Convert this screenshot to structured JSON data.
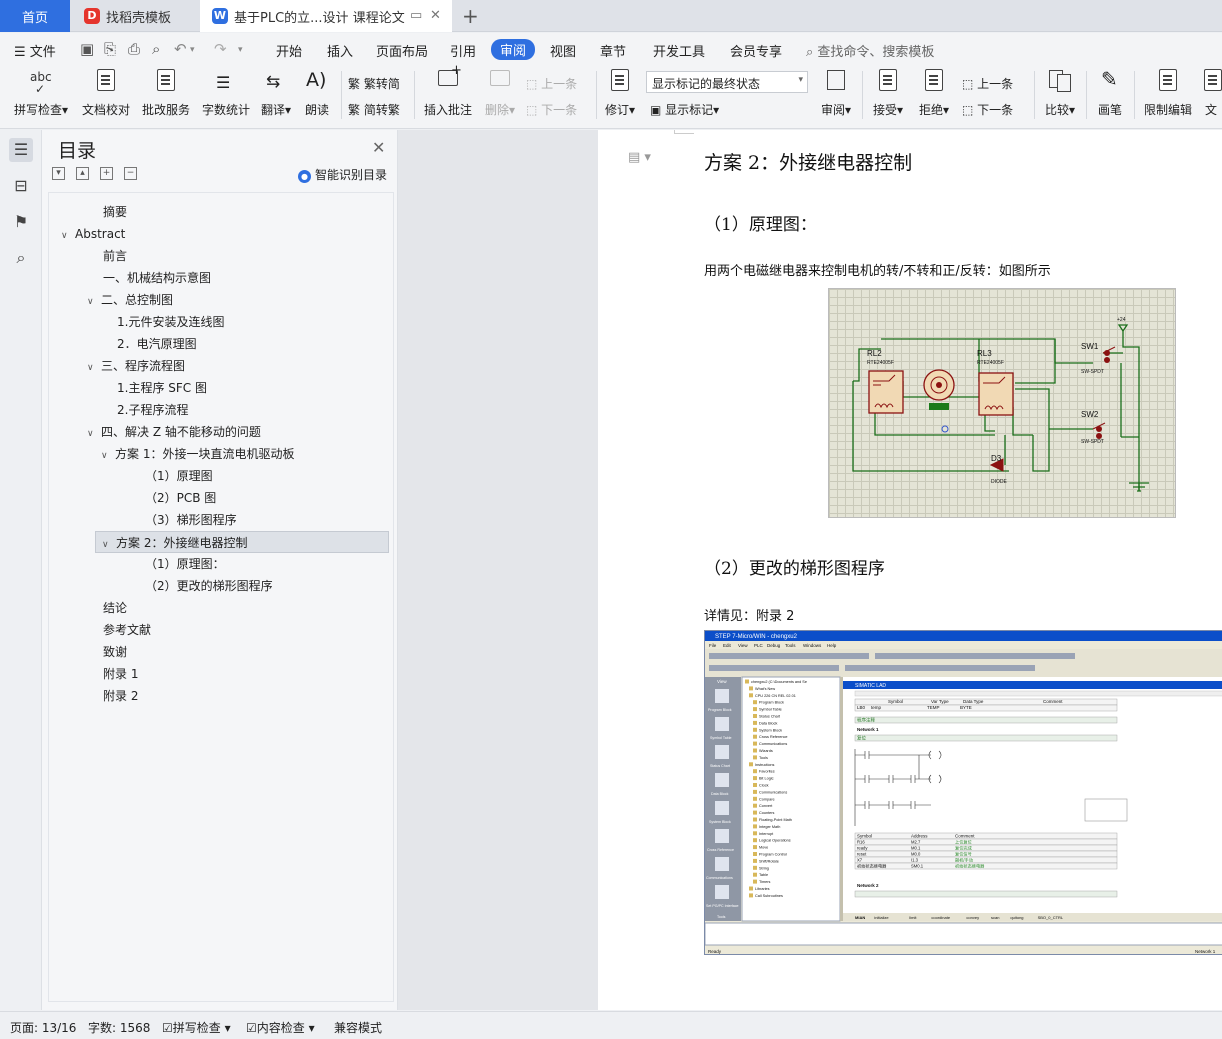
{
  "tabs": {
    "home": "首页",
    "template": "找稻壳模板",
    "doc": "基于PLC的立...设计 课程论文",
    "new": "+"
  },
  "menu": {
    "file": "文件",
    "items": [
      "开始",
      "插入",
      "页面布局",
      "引用",
      "审阅",
      "视图",
      "章节",
      "开发工具",
      "会员专享"
    ],
    "active": "审阅",
    "search": "查找命令、搜索模板"
  },
  "ribbon": {
    "spell": "拼写检查",
    "proofread": "文档校对",
    "batch": "批改服务",
    "wordcount": "字数统计",
    "translate": "翻译",
    "read": "朗读",
    "to_simp": "繁转简",
    "to_trad": "简转繁",
    "insert_comment": "插入批注",
    "delete": "删除",
    "prev": "上一条",
    "next": "下一条",
    "revise": "修订",
    "mark_state": "显示标记的最终状态",
    "show_mark": "显示标记",
    "review": "审阅",
    "accept": "接受",
    "reject": "拒绝",
    "prev2": "上一条",
    "next2": "下一条",
    "compare": "比较",
    "pen": "画笔",
    "restrict": "限制编辑",
    "doc_right": "文"
  },
  "toc": {
    "title": "目录",
    "smart": "智能识别目录",
    "items": [
      {
        "label": "摘要",
        "level": 1,
        "arrow": ""
      },
      {
        "label": "Abstract",
        "level": 0,
        "arrow": "v"
      },
      {
        "label": "前言",
        "level": 1,
        "arrow": ""
      },
      {
        "label": "一、机械结构示意图",
        "level": 1,
        "arrow": ""
      },
      {
        "label": "二、总控制图",
        "level": 1,
        "arrow": "v"
      },
      {
        "label": "1.元件安装及连线图",
        "level": 2,
        "arrow": ""
      },
      {
        "label": "2．电汽原理图",
        "level": 2,
        "arrow": ""
      },
      {
        "label": "三、程序流程图",
        "level": 1,
        "arrow": "v"
      },
      {
        "label": "1.主程序 SFC 图",
        "level": 2,
        "arrow": ""
      },
      {
        "label": "2.子程序流程",
        "level": 2,
        "arrow": ""
      },
      {
        "label": "四、解决 Z 轴不能移动的问题",
        "level": 1,
        "arrow": "v"
      },
      {
        "label": "方案 1：外接一块直流电机驱动板",
        "level": 2,
        "arrow": "v"
      },
      {
        "label": "（1）原理图",
        "level": 3,
        "arrow": ""
      },
      {
        "label": "（2）PCB 图",
        "level": 3,
        "arrow": ""
      },
      {
        "label": "（3）梯形图程序",
        "level": 3,
        "arrow": ""
      },
      {
        "label": "方案 2：外接继电器控制",
        "level": 2,
        "arrow": "v",
        "selected": true
      },
      {
        "label": "（1）原理图：",
        "level": 3,
        "arrow": ""
      },
      {
        "label": "（2）更改的梯形图程序",
        "level": 3,
        "arrow": ""
      },
      {
        "label": "结论",
        "level": 1,
        "arrow": ""
      },
      {
        "label": "参考文献",
        "level": 1,
        "arrow": ""
      },
      {
        "label": "致谢",
        "level": 1,
        "arrow": ""
      },
      {
        "label": "附录 1",
        "level": 1,
        "arrow": ""
      },
      {
        "label": "附录 2",
        "level": 1,
        "arrow": ""
      }
    ]
  },
  "doc": {
    "heading": "方案 2：外接继电器控制",
    "sub1": "（1）原理图：",
    "para1": "用两个电磁继电器来控制电机的转/不转和正/反转：如图所示",
    "sub2": "（2）更改的梯形图程序",
    "para2": "详情见：附录 2"
  },
  "circuit": {
    "rl2": "RL2",
    "rl2_part": "RTE24005F",
    "rl3": "RL3",
    "rl3_part": "RTE24005F",
    "sw1": "SW1",
    "sw1_part": "SW-SPDT",
    "sw2": "SW2",
    "sw2_part": "SW-SPDT",
    "d3": "D3",
    "d3_part": "DIODE",
    "vcc": "+24"
  },
  "step7": {
    "title": "STEP 7-Micro/WIN - chengxu2",
    "menus": [
      "File",
      "Edit",
      "View",
      "PLC",
      "Debug",
      "Tools",
      "Windows",
      "Help"
    ],
    "nav": [
      "Program Block",
      "Symbol Table",
      "Status Chart",
      "Data Block",
      "System Block",
      "Cross Reference",
      "Communications",
      "Set PG/PC Interface"
    ],
    "nav_header": "View",
    "nav_footer": "Tools",
    "tree": [
      "chengxu2 (C:\\Documents and Se",
      "What's New",
      "CPU 226 CN REL 02.01",
      "Program Block",
      "Symbol Table",
      "Status Chart",
      "Data Block",
      "System Block",
      "Cross Reference",
      "Communications",
      "Wizards",
      "Tools",
      "Instructions",
      "Favorites",
      "Bit Logic",
      "Clock",
      "Communications",
      "Compare",
      "Convert",
      "Counters",
      "Floating-Point Math",
      "Integer Math",
      "Interrupt",
      "Logical Operations",
      "Move",
      "Program Control",
      "Shift/Rotate",
      "String",
      "Table",
      "Timers",
      "Libraries",
      "Call Subroutines"
    ],
    "lad_title": "SIMATIC LAD",
    "var_cols": [
      "Symbol",
      "Var Type",
      "Data Type",
      "Comment"
    ],
    "var_row": [
      "LB0",
      "temp",
      "TEMP",
      "BYTE"
    ],
    "network1": "Network 1",
    "network2": "Network 2",
    "comment1": "程序注释",
    "comment2": "复位",
    "sym_cols": [
      "Symbol",
      "Address",
      "Comment"
    ],
    "sym_rows": [
      [
        "R16",
        "M2.7",
        "上位复位"
      ],
      [
        "ready",
        "M0.1",
        "复位完成"
      ],
      [
        "reset",
        "M0.0",
        "复位信号"
      ],
      [
        "X7",
        "I1.3",
        "副机/手动"
      ],
      [
        "初始状态继电器",
        "SM0.1",
        "初始状态继电器"
      ]
    ],
    "tabs": [
      "MIAN",
      "initialize",
      "limit",
      "coordinate",
      "convey",
      "scan",
      "quitong",
      "SBO_0_CTRL"
    ],
    "status_left": "Ready",
    "status_right": "Network 1"
  },
  "statusbar": {
    "page": "页面: 13/16",
    "words": "字数: 1568",
    "spell": "拼写检查",
    "content": "内容检查",
    "compat": "兼容模式"
  }
}
